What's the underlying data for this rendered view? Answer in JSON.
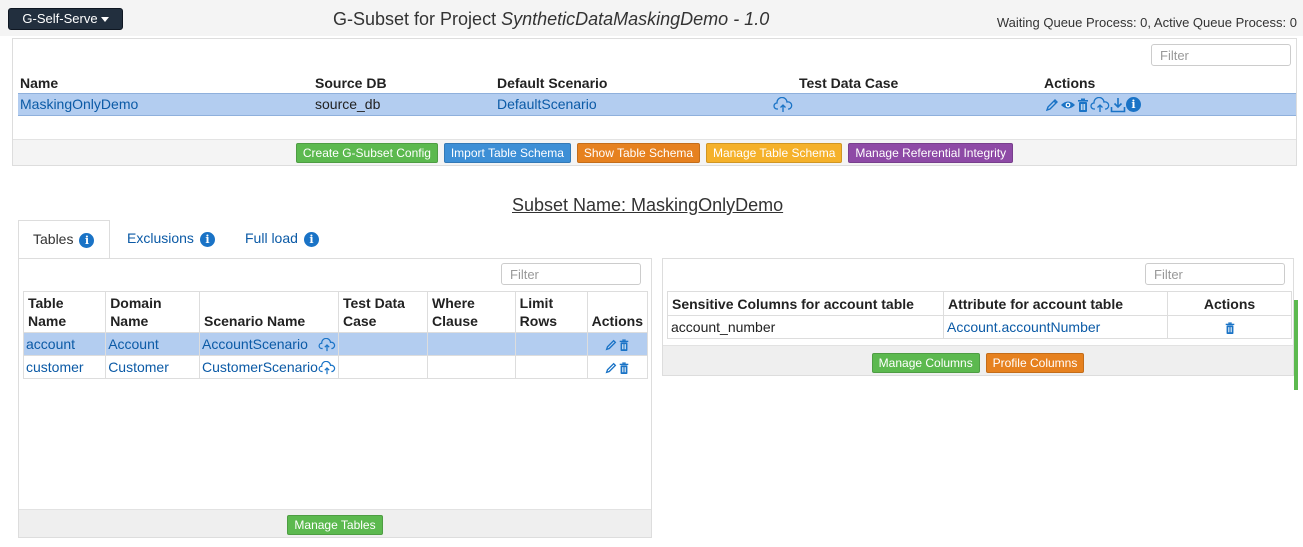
{
  "header": {
    "app_menu_label": "G-Self-Serve",
    "title_prefix": "G-Subset for Project ",
    "project_name": "SyntheticDataMaskingDemo",
    "title_version": " - 1.0",
    "queue_status": "Waiting Queue Process: 0, Active Queue Process: 0"
  },
  "subsets": {
    "filter_placeholder": "Filter",
    "columns": [
      "Name",
      "Source DB",
      "Default Scenario",
      "Test Data Case",
      "Actions"
    ],
    "rows": [
      {
        "name": "MaskingOnlyDemo",
        "source_db": "source_db",
        "default_scenario": "DefaultScenario"
      }
    ],
    "buttons": {
      "create_config": "Create G-Subset Config",
      "import_schema": "Import Table Schema",
      "show_schema": "Show Table Schema",
      "manage_schema": "Manage Table Schema",
      "manage_ri": "Manage Referential Integrity"
    }
  },
  "subset_detail": {
    "heading": "Subset Name: MaskingOnlyDemo",
    "tabs": [
      "Tables",
      "Exclusions",
      "Full load"
    ],
    "active_tab": "Tables"
  },
  "tables_panel": {
    "filter_placeholder": "Filter",
    "columns": [
      "Table Name",
      "Domain Name",
      "Scenario Name",
      "Test Data Case",
      "Where Clause",
      "Limit Rows",
      "Actions"
    ],
    "rows": [
      {
        "table": "account",
        "domain": "Account",
        "scenario": "AccountScenario"
      },
      {
        "table": "customer",
        "domain": "Customer",
        "scenario": "CustomerScenario"
      }
    ],
    "manage_button": "Manage Tables"
  },
  "columns_panel": {
    "filter_placeholder": "Filter",
    "columns": [
      "Sensitive Columns for account table",
      "Attribute for account table",
      "Actions"
    ],
    "rows": [
      {
        "column": "account_number",
        "attribute": "Account.accountNumber"
      }
    ],
    "buttons": {
      "manage_columns": "Manage Columns",
      "profile_columns": "Profile Columns"
    }
  },
  "colors": {
    "selected_row": "#b3cdf0",
    "link": "#0b5aa6",
    "green": "#5cb94f",
    "blue": "#3d8fd6",
    "orange": "#e6811f",
    "yellow": "#f5b12a",
    "purple": "#8e4aa6",
    "app_button": "#222f3e"
  }
}
